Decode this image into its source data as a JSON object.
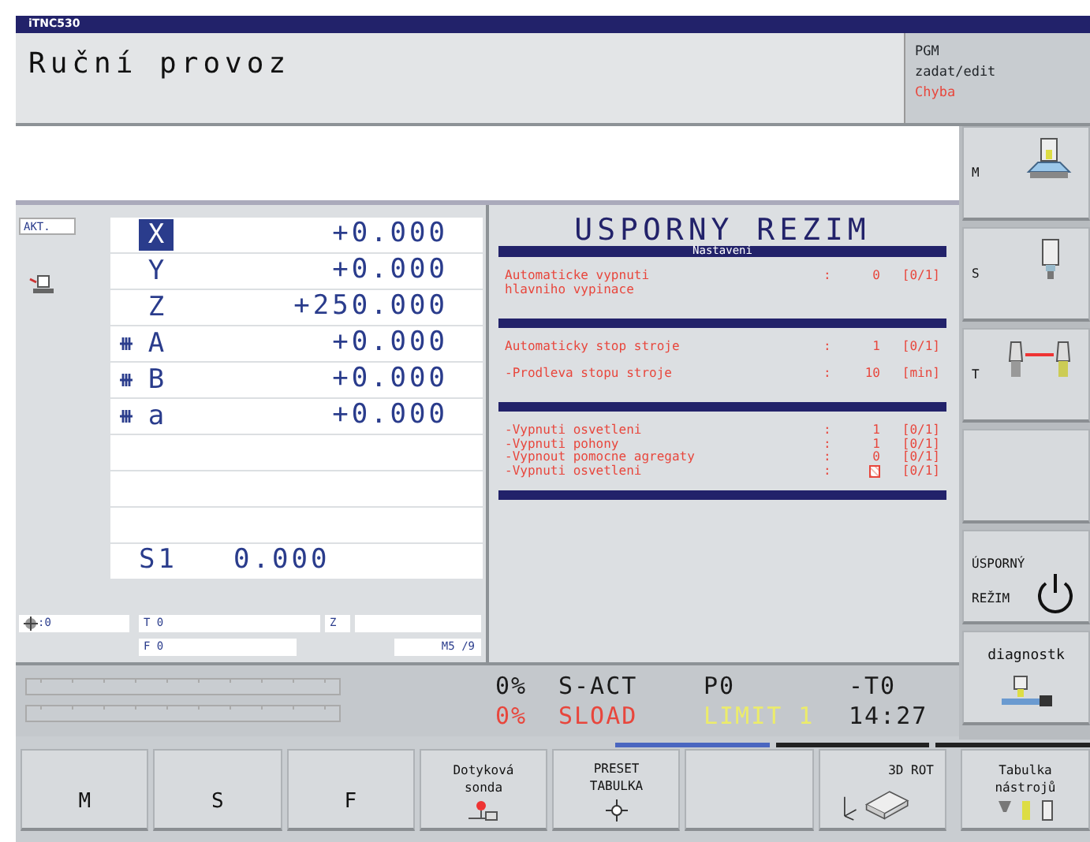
{
  "window": {
    "title": "iTNC530"
  },
  "header": {
    "mode": "Ruční provoz",
    "side_lines": [
      "PGM",
      "zadat/edit"
    ],
    "error": "Chyba"
  },
  "positions": {
    "label": "AKT.",
    "axes": [
      {
        "axis": "X",
        "value": "+0.000",
        "selected": true,
        "clamped": false
      },
      {
        "axis": "Y",
        "value": "+0.000",
        "selected": false,
        "clamped": false
      },
      {
        "axis": "Z",
        "value": "+250.000",
        "selected": false,
        "clamped": false
      },
      {
        "axis": "A",
        "value": "+0.000",
        "selected": false,
        "clamped": true
      },
      {
        "axis": "B",
        "value": "+0.000",
        "selected": false,
        "clamped": true
      },
      {
        "axis": "a",
        "value": "+0.000",
        "selected": false,
        "clamped": true
      }
    ],
    "spindle": {
      "label": "S1",
      "value": "0.000"
    },
    "fields": {
      "datum": ":0",
      "tool": "T 0",
      "tool_axis": "Z",
      "feed": "F 0",
      "misc": "M5 /9"
    }
  },
  "dialog": {
    "title": "USPORNY REZIM",
    "subtitle": "Nastaveni",
    "groups": [
      [
        {
          "label": "Automaticke vypnuti\nhlavniho vypinace",
          "separator": ":",
          "value": "0",
          "range": "[0/1]"
        }
      ],
      [
        {
          "label": "Automaticky stop stroje",
          "separator": ":",
          "value": "1",
          "range": "[0/1]"
        },
        {
          "label": "-Prodleva stopu stroje",
          "separator": ":",
          "value": "10",
          "range": "[min]"
        }
      ],
      [
        {
          "label": "-Vypnuti osvetleni",
          "separator": ":",
          "value": "1",
          "range": "[0/1]",
          "cursor": false
        },
        {
          "label": "-Vypnuti pohony",
          "separator": ":",
          "value": "1",
          "range": "[0/1]",
          "cursor": false
        },
        {
          "label": "-Vypnout pomocne agregaty",
          "separator": ":",
          "value": "0",
          "range": "[0/1]",
          "cursor": false
        },
        {
          "label": "-Vypnuti osvetleni",
          "separator": ":",
          "range": "[0/1]",
          "cursor": true
        }
      ]
    ]
  },
  "status": {
    "rows": [
      [
        {
          "text": "0%",
          "color": "#1a1a1a"
        },
        {
          "text": "S-ACT",
          "color": "#1a1a1a"
        },
        {
          "text": "P0",
          "color": "#1a1a1a"
        },
        {
          "text": "-T0",
          "color": "#1a1a1a"
        }
      ],
      [
        {
          "text": "0%",
          "color": "#e8463c"
        },
        {
          "text": "SLOAD",
          "color": "#e8463c"
        },
        {
          "text": "LIMIT 1",
          "color": "#ecec6a"
        },
        {
          "text": "14:27",
          "color": "#1a1a1a"
        }
      ]
    ]
  },
  "side_keys": [
    {
      "label": "M",
      "kind": "m"
    },
    {
      "label": "S",
      "kind": "s"
    },
    {
      "label": "T",
      "kind": "t"
    },
    {
      "kind": "blank"
    },
    {
      "label": "ÚSPORNÝ\nREŽIM",
      "kind": "power"
    },
    {
      "label": "diagnostk",
      "kind": "diag"
    }
  ],
  "soft_keys": [
    {
      "label": "M",
      "kind": "text"
    },
    {
      "label": "S",
      "kind": "text"
    },
    {
      "label": "F",
      "kind": "text"
    },
    {
      "label": "Dotyková\nsonda",
      "kind": "probe"
    },
    {
      "label": "PRESET\nTABULKA",
      "kind": "preset"
    },
    {
      "kind": "blank"
    },
    {
      "label": "3D ROT",
      "kind": "rot"
    },
    {
      "label": "Tabulka\nnástrojů",
      "kind": "tools"
    }
  ]
}
